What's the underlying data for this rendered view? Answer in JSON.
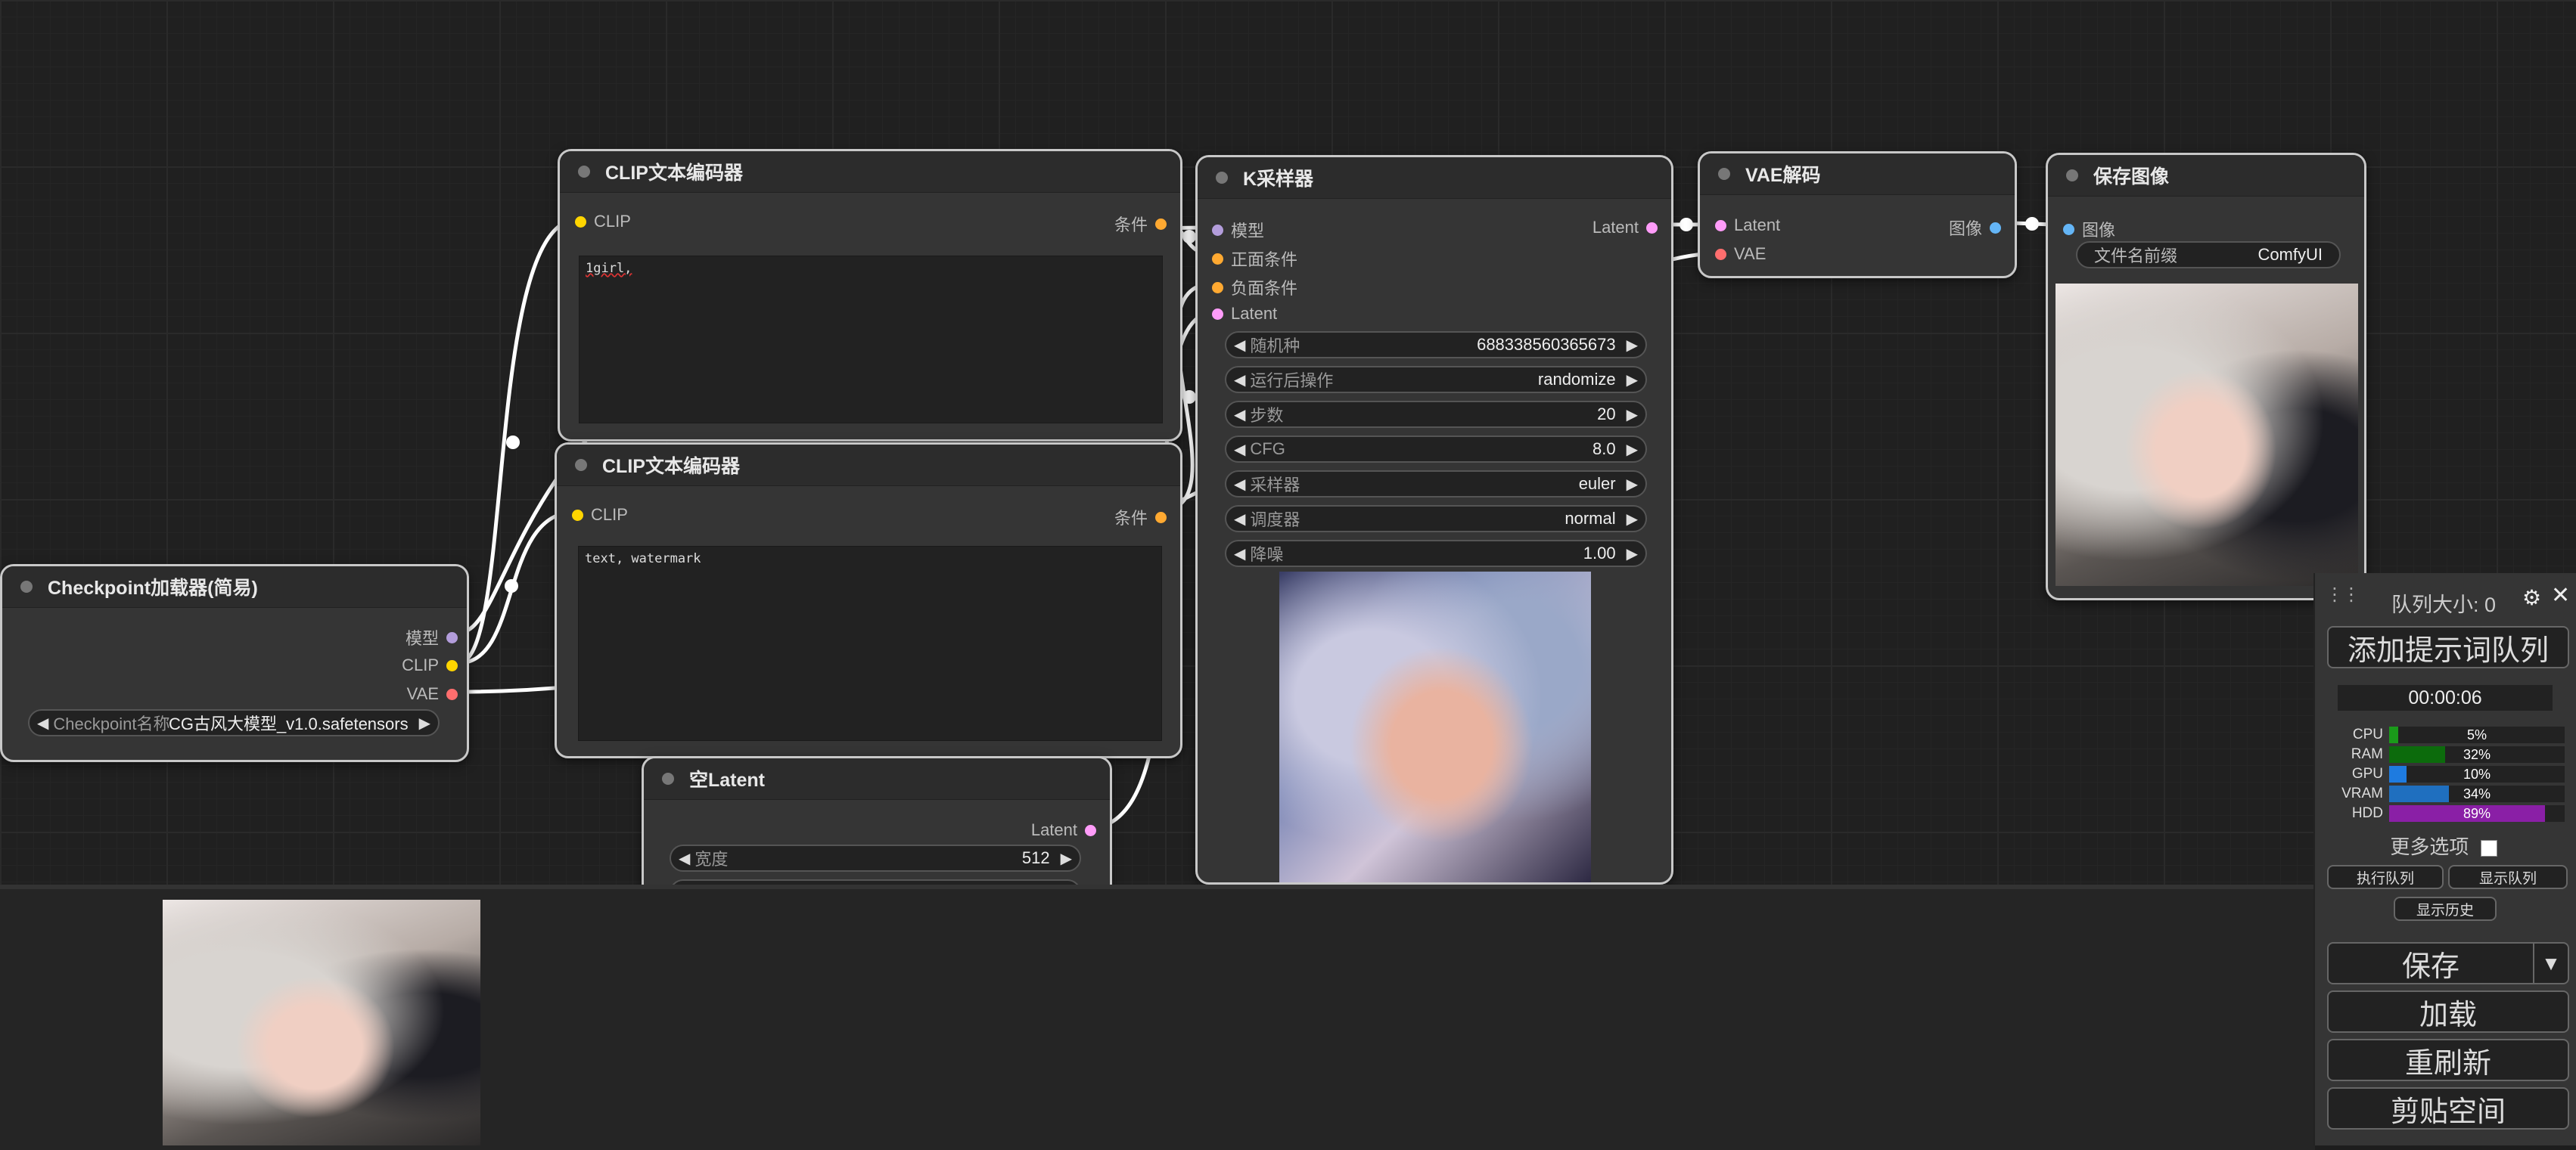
{
  "colors": {
    "model": "#b39ddb",
    "clip": "#ffd500",
    "vae": "#ff6e6e",
    "conditioning": "#ffa931",
    "latent": "#ff9cf9",
    "image": "#64b5f6"
  },
  "nodes": {
    "checkpoint": {
      "title": "Checkpoint加载器(简易)",
      "out_model": "模型",
      "out_clip": "CLIP",
      "out_vae": "VAE",
      "ckpt_label": "Checkpoint名称",
      "ckpt_value": "CG古风大模型_v1.0.safetensors"
    },
    "clip_pos": {
      "title": "CLIP文本编码器",
      "in": "CLIP",
      "out": "条件",
      "text": "1girl,"
    },
    "clip_neg": {
      "title": "CLIP文本编码器",
      "in": "CLIP",
      "out": "条件",
      "text": "text, watermark"
    },
    "latent": {
      "title": "空Latent",
      "out": "Latent",
      "width_label": "宽度",
      "width_value": "512"
    },
    "ksampler": {
      "title": "K采样器",
      "in_model": "模型",
      "in_pos": "正面条件",
      "in_neg": "负面条件",
      "in_latent": "Latent",
      "out": "Latent",
      "widgets": [
        {
          "name": "随机种",
          "value": "688338560365673"
        },
        {
          "name": "运行后操作",
          "value": "randomize"
        },
        {
          "name": "步数",
          "value": "20"
        },
        {
          "name": "CFG",
          "value": "8.0"
        },
        {
          "name": "采样器",
          "value": "euler"
        },
        {
          "name": "调度器",
          "value": "normal"
        },
        {
          "name": "降噪",
          "value": "1.00"
        }
      ]
    },
    "vae": {
      "title": "VAE解码",
      "in_latent": "Latent",
      "in_vae": "VAE",
      "out": "图像"
    },
    "save": {
      "title": "保存图像",
      "in": "图像",
      "prefix_label": "文件名前缀",
      "prefix_value": "ComfyUI"
    }
  },
  "menu": {
    "queue_size": "队列大小: 0",
    "queue_prompt": "添加提示词队列",
    "timer": "00:00:06",
    "monitors": [
      {
        "label": "CPU",
        "percent": "5%",
        "fill": 5,
        "color": "#1a9a1a"
      },
      {
        "label": "RAM",
        "percent": "32%",
        "fill": 32,
        "color": "#0c6b0c"
      },
      {
        "label": "GPU",
        "percent": "10%",
        "fill": 10,
        "color": "#1e7be0"
      },
      {
        "label": "VRAM",
        "percent": "34%",
        "fill": 34,
        "color": "#1f6fbf"
      },
      {
        "label": "HDD",
        "percent": "89%",
        "fill": 89,
        "color": "#8a1fa6"
      }
    ],
    "more_options": "更多选项",
    "view_queue": "执行队列",
    "view_list": "显示队列",
    "view_history": "显示历史",
    "save": "保存",
    "load": "加载",
    "refresh": "重刷新",
    "clipspace": "剪贴空间"
  }
}
